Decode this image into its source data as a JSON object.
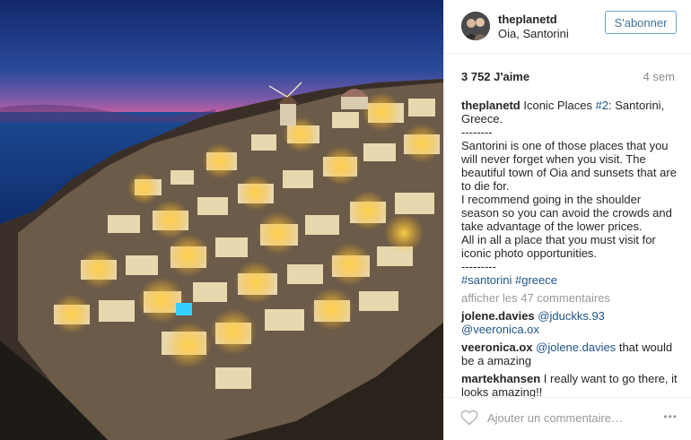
{
  "header": {
    "username": "theplanetd",
    "location": "Oia, Santorini",
    "follow_label": "S'abonner"
  },
  "stats": {
    "likes": "3 752 J'aime",
    "age": "4 sem"
  },
  "caption": {
    "author": "theplanetd",
    "title_before": "Iconic Places ",
    "title_tag": "#2",
    "title_after": ": Santorini, Greece.",
    "body": "--------\nSantorini is one of those places that you will never forget when you visit. The beautiful town of Oia and sunsets that are to die for.\nI recommend going in the shoulder season so you can avoid the crowds and take advantage of the lower prices.\nAll in all a place that you must visit for iconic photo opportunities.\n---------",
    "hashtag1": "#santorini",
    "hashtag2": "#greece"
  },
  "view_more": "afficher les 47 commentaires",
  "comments": [
    {
      "author": "jolene.davies",
      "mention1": "@jduckks.93",
      "mention2": "@veeronica.ox",
      "text": ""
    },
    {
      "author": "veeronica.ox",
      "mention1": "@jolene.davies",
      "text": "that would be a amazing"
    },
    {
      "author": "martekhansen",
      "text": "I really want to go there, it looks amazing!!"
    }
  ],
  "footer": {
    "placeholder": "Ajouter un commentaire…",
    "more_icon": "•••",
    "like_icon": "heart-icon"
  },
  "colors": {
    "link": "#1f5486",
    "follow_border": "#70a1d5",
    "follow_text": "#3f729b",
    "muted": "#999999"
  }
}
